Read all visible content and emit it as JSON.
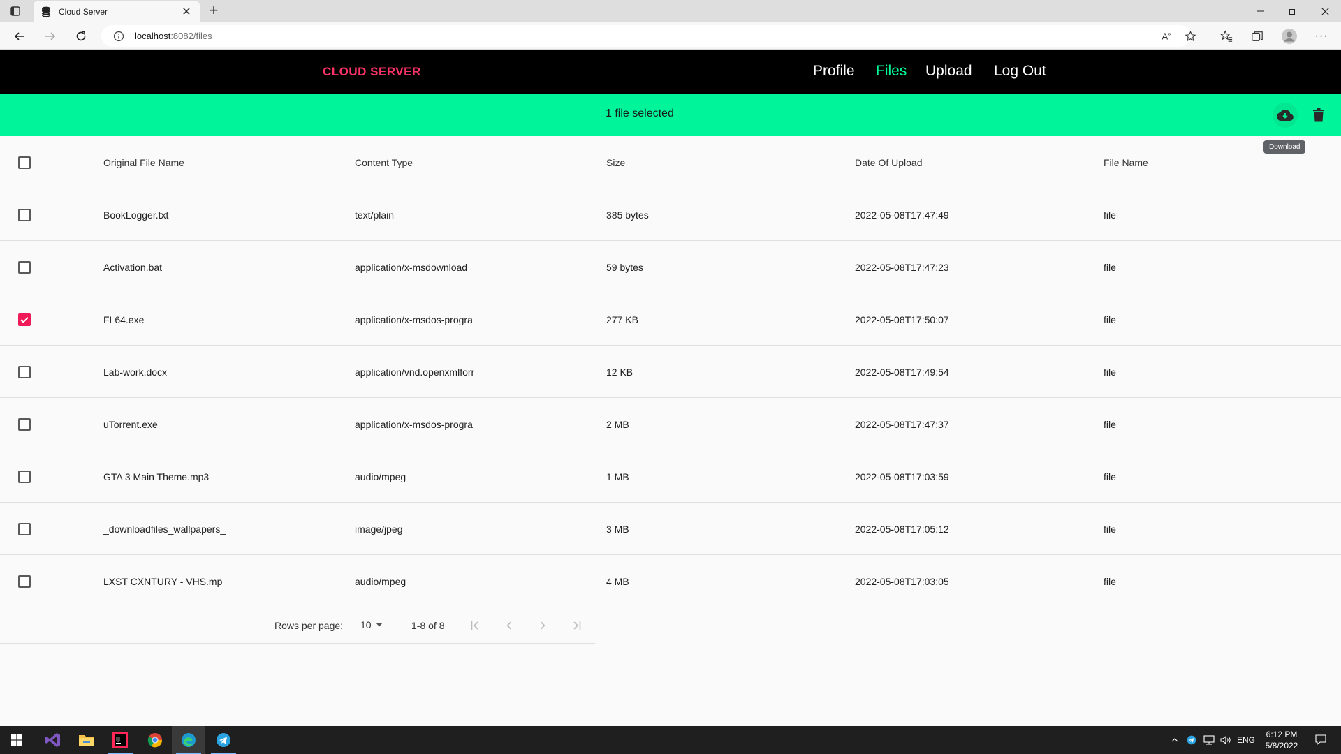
{
  "browser": {
    "tab_title": "Cloud Server",
    "url_host": "localhost",
    "url_path": ":8082/files"
  },
  "app": {
    "brand": "CLOUD SERVER",
    "nav": [
      {
        "label": "Profile",
        "active": false
      },
      {
        "label": "Files",
        "active": true
      },
      {
        "label": "Upload",
        "active": false
      },
      {
        "label": "Log Out",
        "active": false
      }
    ],
    "colors": {
      "brand": "#ff3366",
      "active_nav": "#00ff99",
      "selection_bar": "#00f59b",
      "checkbox_checked": "#ef1a57"
    }
  },
  "selection": {
    "text": "1 file selected",
    "download_tooltip": "Download",
    "download_icon": "cloud-download-icon",
    "delete_icon": "trash-icon"
  },
  "table": {
    "headers": {
      "name": "Original File Name",
      "type": "Content Type",
      "size": "Size",
      "date": "Date Of Upload",
      "file": "File Name"
    },
    "rows": [
      {
        "name": "BookLogger.txt",
        "type": "text/plain",
        "size": "385 bytes",
        "date": "2022-05-08T17:47:49",
        "file": "file",
        "checked": false
      },
      {
        "name": "Activation.bat",
        "type": "application/x-msdownload",
        "size": "59 bytes",
        "date": "2022-05-08T17:47:23",
        "file": "file",
        "checked": false
      },
      {
        "name": "FL64.exe",
        "type": "application/x-msdos-progra",
        "size": "277 KB",
        "date": "2022-05-08T17:50:07",
        "file": "file",
        "checked": true
      },
      {
        "name": "Lab-work.docx",
        "type": "application/vnd.openxmlforr",
        "size": "12 KB",
        "date": "2022-05-08T17:49:54",
        "file": "file",
        "checked": false
      },
      {
        "name": "uTorrent.exe",
        "type": "application/x-msdos-progra",
        "size": "2 MB",
        "date": "2022-05-08T17:47:37",
        "file": "file",
        "checked": false
      },
      {
        "name": "GTA 3 Main Theme.mp3",
        "type": "audio/mpeg",
        "size": "1 MB",
        "date": "2022-05-08T17:03:59",
        "file": "file",
        "checked": false
      },
      {
        "name": "_downloadfiles_wallpapers_",
        "type": "image/jpeg",
        "size": "3 MB",
        "date": "2022-05-08T17:05:12",
        "file": "file",
        "checked": false
      },
      {
        "name": "LXST CXNTURY - VHS.mp",
        "type": "audio/mpeg",
        "size": "4 MB",
        "date": "2022-05-08T17:03:05",
        "file": "file",
        "checked": false
      }
    ]
  },
  "pagination": {
    "rows_per_page_label": "Rows per page:",
    "rows_per_page": "10",
    "range": "1-8 of 8"
  },
  "taskbar": {
    "language": "ENG",
    "time": "6:12 PM",
    "date": "5/8/2022"
  }
}
